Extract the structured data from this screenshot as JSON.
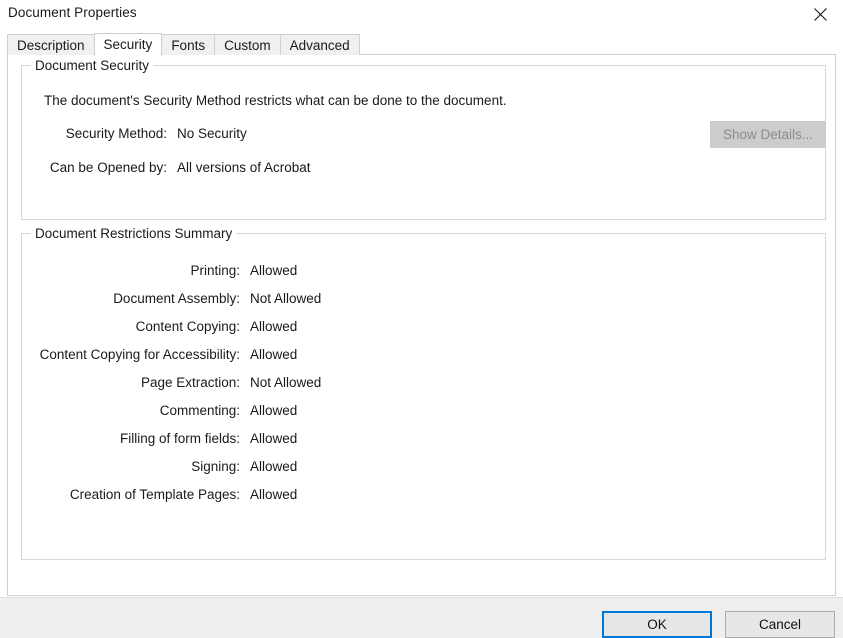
{
  "window": {
    "title": "Document Properties",
    "close_icon": "close-icon"
  },
  "tabs": [
    {
      "label": "Description",
      "active": false
    },
    {
      "label": "Security",
      "active": true
    },
    {
      "label": "Fonts",
      "active": false
    },
    {
      "label": "Custom",
      "active": false
    },
    {
      "label": "Advanced",
      "active": false
    }
  ],
  "document_security": {
    "legend": "Document Security",
    "description": "The document's Security Method restricts what can be done to the document.",
    "fields": [
      {
        "label": "Security Method:",
        "value": "No Security"
      },
      {
        "label": "Can be Opened by:",
        "value": "All versions of Acrobat"
      }
    ],
    "show_details_button": "Show Details..."
  },
  "document_restrictions": {
    "legend": "Document Restrictions Summary",
    "rows": [
      {
        "label": "Printing:",
        "value": "Allowed"
      },
      {
        "label": "Document Assembly:",
        "value": "Not Allowed"
      },
      {
        "label": "Content Copying:",
        "value": "Allowed"
      },
      {
        "label": "Content Copying for Accessibility:",
        "value": "Allowed"
      },
      {
        "label": "Page Extraction:",
        "value": "Not Allowed"
      },
      {
        "label": "Commenting:",
        "value": "Allowed"
      },
      {
        "label": "Filling of form fields:",
        "value": "Allowed"
      },
      {
        "label": "Signing:",
        "value": "Allowed"
      },
      {
        "label": "Creation of Template Pages:",
        "value": "Allowed"
      }
    ]
  },
  "footer": {
    "ok_label": "OK",
    "cancel_label": "Cancel"
  },
  "colors": {
    "accent": "#0078d7",
    "panel_border": "#cfcfcf",
    "group_border": "#d7d7d7",
    "footer_bg": "#efefef",
    "disabled_button_bg": "#cccccc",
    "disabled_button_text": "#8c8c8c"
  }
}
